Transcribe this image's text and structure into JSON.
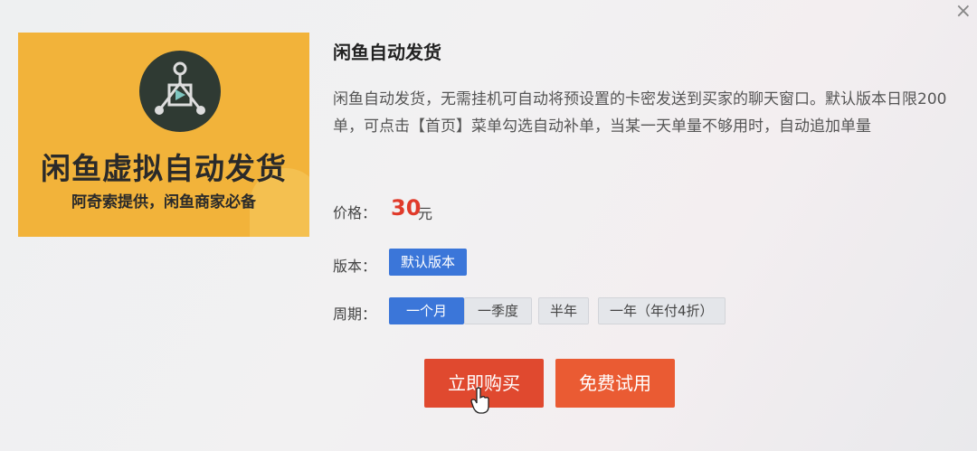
{
  "close_icon": "×",
  "banner": {
    "title": "闲鱼虚拟自动发货",
    "subtitle": "阿奇索提供，闲鱼商家必备"
  },
  "product": {
    "title": "闲鱼自动发货",
    "description": "闲鱼自动发货，无需挂机可自动将预设置的卡密发送到买家的聊天窗口。默认版本日限200单，可点击【首页】菜单勾选自动补单，当某一天单量不够用时，自动追加单量"
  },
  "price": {
    "label": "价格：",
    "value": "30",
    "unit": "元"
  },
  "version": {
    "label": "版本：",
    "options": [
      "默认版本"
    ],
    "selected": "默认版本"
  },
  "cycle": {
    "label": "周期：",
    "options": [
      "一个月",
      "一季度",
      "半年",
      "一年（年付4折）"
    ],
    "selected": "一个月"
  },
  "buttons": {
    "buy": "立即购买",
    "trial": "免费试用"
  },
  "colors": {
    "accent_blue": "#3b76d9",
    "price_red": "#e03a2a",
    "button_red": "#e0492f",
    "banner_yellow": "#f2b33a"
  }
}
